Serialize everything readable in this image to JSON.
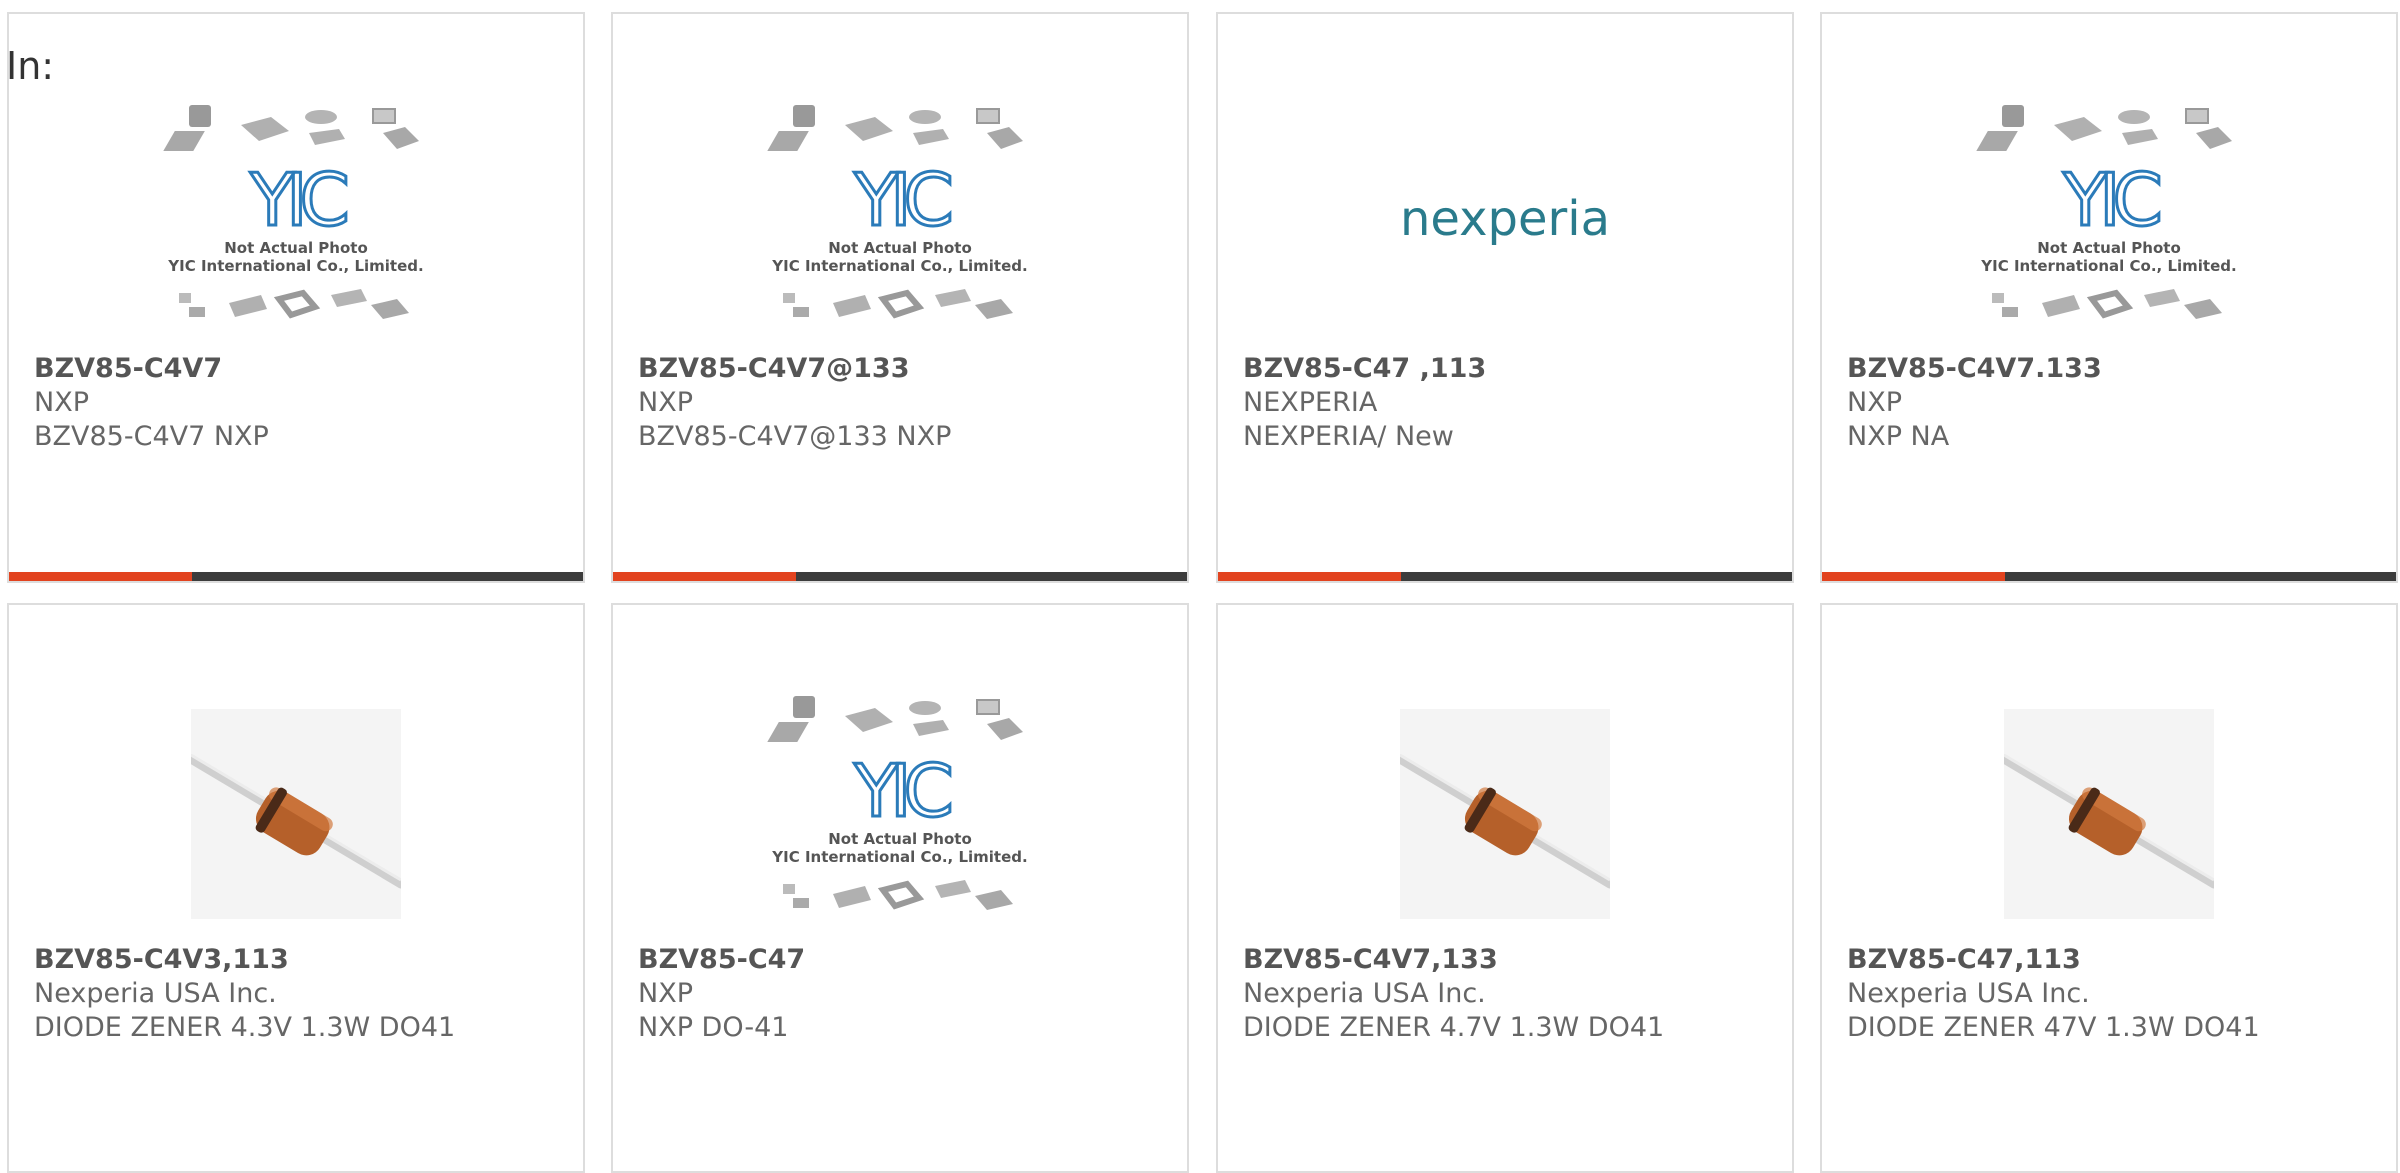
{
  "header": {
    "label": "In:"
  },
  "colors": {
    "accent": "#e2431f",
    "bar": "#3c3c3c",
    "border": "#dddddd",
    "text": "#666666"
  },
  "placeholder": {
    "line1": "Not Actual Photo",
    "line2": "YIC International Co., Limited.",
    "logo": "YIC"
  },
  "products": [
    {
      "part": "BZV85-C4V7",
      "manufacturer": "NXP",
      "description": "BZV85-C4V7 NXP",
      "image": "yic-placeholder-icon"
    },
    {
      "part": "BZV85-C4V7@133",
      "manufacturer": "NXP",
      "description": "BZV85-C4V7@133 NXP",
      "image": "yic-placeholder-icon"
    },
    {
      "part": "BZV85-C47 ,113",
      "manufacturer": "NEXPERIA",
      "description": "NEXPERIA/ New",
      "image": "nexperia-logo",
      "logo_text": "nexperia"
    },
    {
      "part": "BZV85-C4V7.133",
      "manufacturer": "NXP",
      "description": "NXP NA",
      "image": "yic-placeholder-icon"
    },
    {
      "part": "BZV85-C4V3,113",
      "manufacturer": "Nexperia USA Inc.",
      "description": "DIODE ZENER 4.3V 1.3W DO41",
      "image": "diode-icon"
    },
    {
      "part": "BZV85-C47",
      "manufacturer": "NXP",
      "description": "NXP DO-41",
      "image": "yic-placeholder-icon"
    },
    {
      "part": "BZV85-C4V7,133",
      "manufacturer": "Nexperia USA Inc.",
      "description": "DIODE ZENER 4.7V 1.3W DO41",
      "image": "diode-icon"
    },
    {
      "part": "BZV85-C47,113",
      "manufacturer": "Nexperia USA Inc.",
      "description": "DIODE ZENER 47V 1.3W DO41",
      "image": "diode-icon"
    }
  ]
}
